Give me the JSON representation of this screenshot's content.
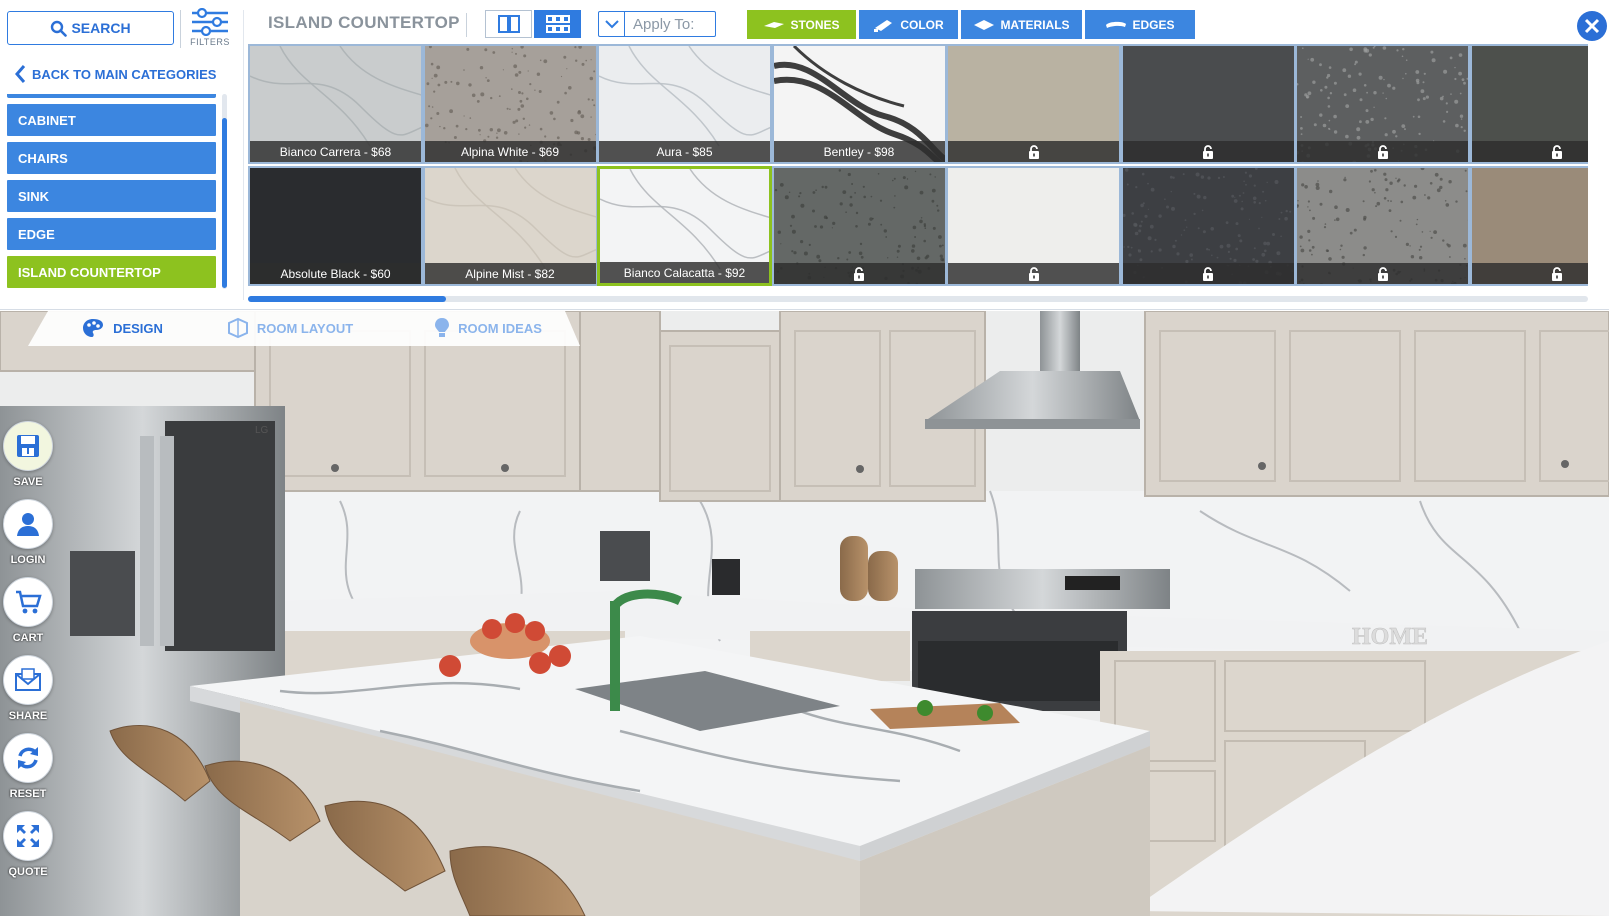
{
  "toolbar": {
    "search_label": "SEARCH",
    "filters_label": "FILTERS",
    "back_label": "BACK TO MAIN CATEGORIES"
  },
  "categories": [
    {
      "label": "CABINET"
    },
    {
      "label": "CHAIRS"
    },
    {
      "label": "SINK"
    },
    {
      "label": "EDGE"
    },
    {
      "label": "ISLAND COUNTERTOP",
      "active": true
    }
  ],
  "panel": {
    "title": "ISLAND COUNTERTOP",
    "apply_to_placeholder": "Apply To:",
    "type_tabs": [
      {
        "label": "STONES",
        "active": true,
        "icon": "stone-slab-icon"
      },
      {
        "label": "COLOR",
        "active": false,
        "icon": "paint-roller-icon"
      },
      {
        "label": "MATERIALS",
        "active": false,
        "icon": "material-diamond-icon"
      },
      {
        "label": "EDGES",
        "active": false,
        "icon": "edge-profile-icon"
      }
    ]
  },
  "swatches": [
    {
      "name": "Bianco Carrera",
      "price": "$68",
      "color": "#c9cccd",
      "vein": "#aab0b3"
    },
    {
      "name": "Alpina White",
      "price": "$69",
      "color": "#a6a09a",
      "speckle": "#6a625b"
    },
    {
      "name": "Aura",
      "price": "$85",
      "color": "#ebedef",
      "vein": "#b9bec4"
    },
    {
      "name": "Bentley",
      "price": "$98",
      "color": "#f4f4f4",
      "vein": "#1d1d1d"
    },
    {
      "name": "",
      "price": "",
      "locked": true,
      "color": "#b9b2a2"
    },
    {
      "name": "",
      "price": "",
      "locked": true,
      "color": "#4a4c4e"
    },
    {
      "name": "",
      "price": "",
      "locked": true,
      "color": "#5d5f60",
      "speckle": "#9b9c9c"
    },
    {
      "name": "",
      "price": "",
      "locked": true,
      "color": "#4d504c"
    },
    {
      "name": "Absolute Black",
      "price": "$60",
      "color": "#2a2c2f"
    },
    {
      "name": "Alpine Mist",
      "price": "$82",
      "color": "#dcd6cc",
      "vein": "#c9c2b6"
    },
    {
      "name": "Bianco Calacatta",
      "price": "$92",
      "color": "#f3f4f5",
      "vein": "#b0b4b8",
      "selected": true
    },
    {
      "name": "",
      "price": "",
      "locked": true,
      "color": "#646866",
      "speckle": "#3e423f"
    },
    {
      "name": "",
      "price": "",
      "locked": true,
      "color": "#eeeeec"
    },
    {
      "name": "",
      "price": "",
      "locked": true,
      "color": "#3d3f43",
      "speckle": "#55585c"
    },
    {
      "name": "",
      "price": "",
      "locked": true,
      "color": "#8c8c8a",
      "speckle": "#4e4e4c"
    },
    {
      "name": "",
      "price": "",
      "locked": true,
      "color": "#9a8b79"
    }
  ],
  "scene_tabs": [
    {
      "label": "DESIGN",
      "active": true,
      "icon": "palette-icon"
    },
    {
      "label": "ROOM LAYOUT",
      "active": false,
      "icon": "room-layout-icon"
    },
    {
      "label": "ROOM IDEAS",
      "active": false,
      "icon": "lightbulb-icon"
    }
  ],
  "side_tools": [
    {
      "label": "SAVE",
      "icon": "save-icon"
    },
    {
      "label": "LOGIN",
      "icon": "user-icon"
    },
    {
      "label": "CART",
      "icon": "cart-icon"
    },
    {
      "label": "SHARE",
      "icon": "share-mail-icon"
    },
    {
      "label": "RESET",
      "icon": "reset-icon"
    },
    {
      "label": "QUOTE",
      "icon": "quote-compress-icon"
    }
  ],
  "scene_text": {
    "fridge_brand": "LG",
    "decor_word": "HOME"
  },
  "colors": {
    "accent_blue": "#3c86e0",
    "accent_green": "#8dc21f",
    "link_blue": "#2b6fd6"
  }
}
